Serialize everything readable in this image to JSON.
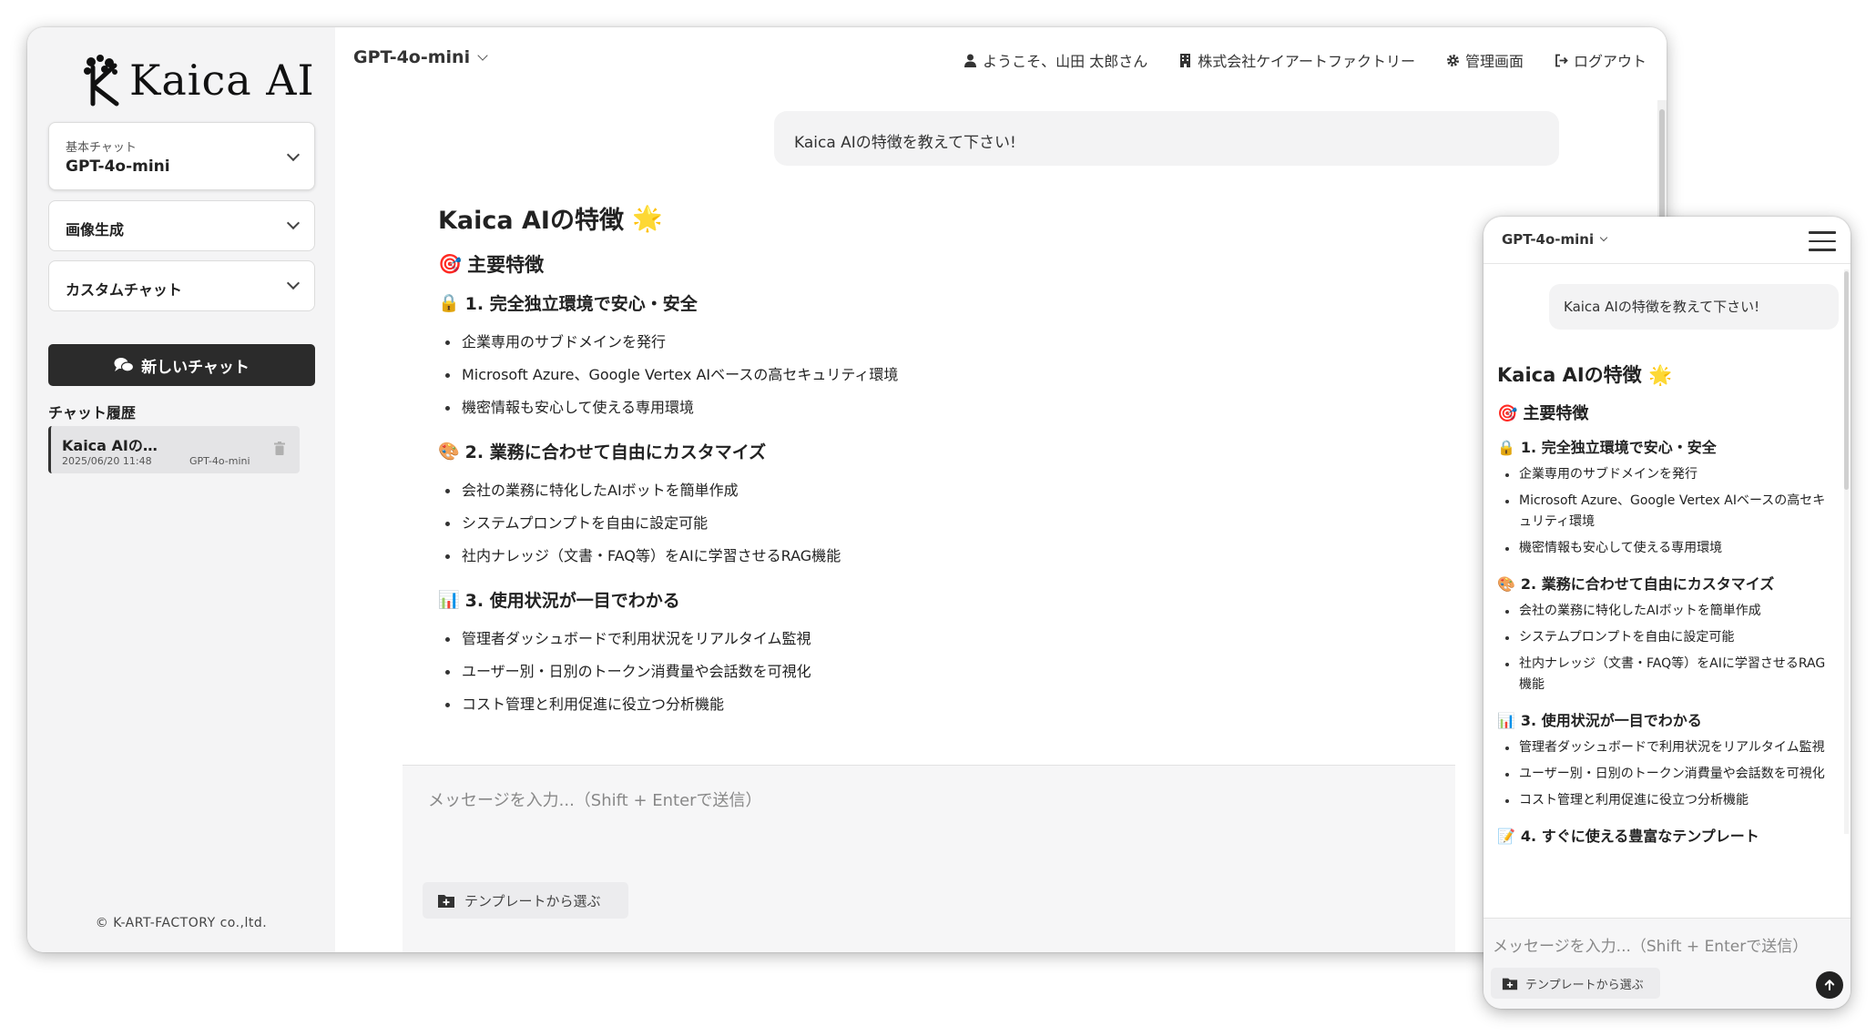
{
  "brand": {
    "name": "Kaica AI"
  },
  "sidebar": {
    "basic_chat": {
      "caption": "基本チャット",
      "value": "GPT-4o-mini"
    },
    "image_gen": {
      "label": "画像生成"
    },
    "custom_chat": {
      "label": "カスタムチャット"
    },
    "new_chat_label": "新しいチャット",
    "history_title": "チャット履歴",
    "history": [
      {
        "title": "Kaica AIの…",
        "date": "2025/06/20 11:48",
        "model": "GPT-4o-mini"
      }
    ],
    "copyright": "© K-ART-FACTORY co.,ltd."
  },
  "header": {
    "model": "GPT-4o-mini",
    "welcome": "ようこそ、山田 太郎さん",
    "company": "株式会社ケイアートファクトリー",
    "admin": "管理画面",
    "logout": "ログアウト"
  },
  "chat": {
    "user_message": "Kaica AIの特徴を教えて下さい!",
    "title": "Kaica AIの特徴",
    "title_emoji": "🌟",
    "main_heading": "主要特徴",
    "main_emoji": "🎯",
    "sections": [
      {
        "emoji": "🔒",
        "title": "1. 完全独立環境で安心・安全",
        "items": [
          "企業専用のサブドメインを発行",
          "Microsoft Azure、Google Vertex AIベースの高セキュリティ環境",
          "機密情報も安心して使える専用環境"
        ]
      },
      {
        "emoji": "🎨",
        "title": "2. 業務に合わせて自由にカスタマイズ",
        "items": [
          "会社の業務に特化したAIボットを簡単作成",
          "システムプロンプトを自由に設定可能",
          "社内ナレッジ（文書・FAQ等）をAIに学習させるRAG機能"
        ]
      },
      {
        "emoji": "📊",
        "title": "3. 使用状況が一目でわかる",
        "items": [
          "管理者ダッシュボードで利用状況をリアルタイム監視",
          "ユーザー別・日別のトークン消費量や会話数を可視化",
          "コスト管理と利用促進に役立つ分析機能"
        ]
      },
      {
        "emoji": "📝",
        "title": "4. すぐに使える豊富なテンプレート",
        "items": []
      }
    ],
    "input_placeholder": "メッセージを入力...（Shift + Enterで送信）",
    "template_button": "テンプレートから選ぶ"
  },
  "mobile": {
    "model": "GPT-4o-mini"
  },
  "colors": {
    "accent_dark": "#2b2b2b",
    "sidebar_bg": "#f4f4f5"
  }
}
